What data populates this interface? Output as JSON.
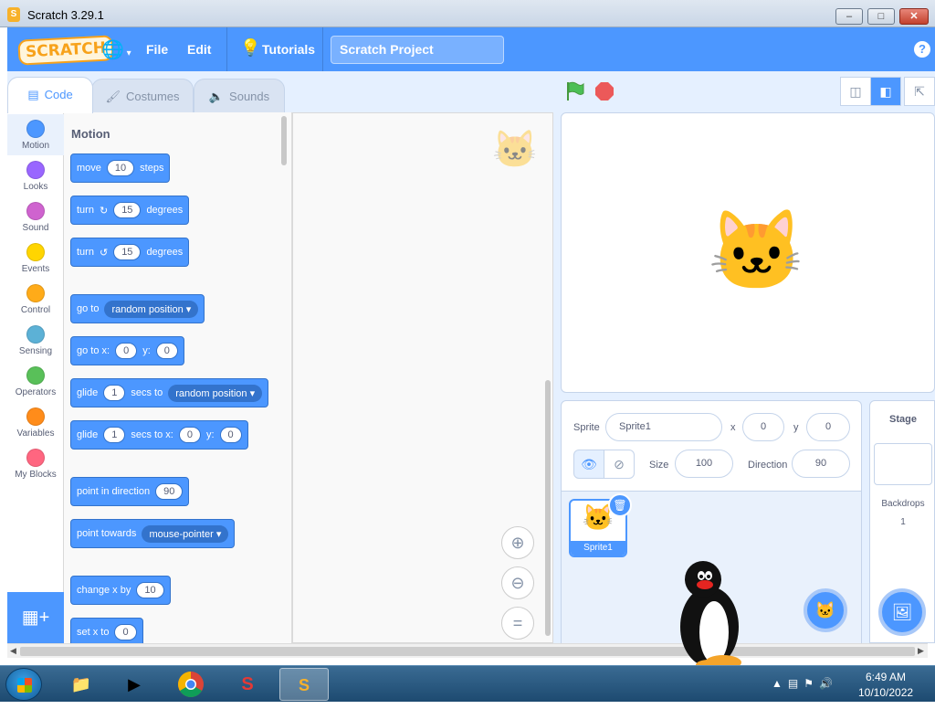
{
  "window": {
    "title": "Scratch 3.29.1"
  },
  "menubar": {
    "logo": "SCRATCH",
    "file": "File",
    "edit": "Edit",
    "tutorials": "Tutorials",
    "project_title": "Scratch Project",
    "help": "?"
  },
  "tabs": [
    {
      "label": "Code",
      "active": true
    },
    {
      "label": "Costumes",
      "active": false
    },
    {
      "label": "Sounds",
      "active": false
    }
  ],
  "categories": [
    {
      "label": "Motion",
      "color": "#4c97ff"
    },
    {
      "label": "Looks",
      "color": "#9966ff"
    },
    {
      "label": "Sound",
      "color": "#cf63cf"
    },
    {
      "label": "Events",
      "color": "#ffd500"
    },
    {
      "label": "Control",
      "color": "#ffab19"
    },
    {
      "label": "Sensing",
      "color": "#5cb1d6"
    },
    {
      "label": "Operators",
      "color": "#59c059"
    },
    {
      "label": "Variables",
      "color": "#ff8c1a"
    },
    {
      "label": "My Blocks",
      "color": "#ff6680"
    }
  ],
  "palette": {
    "title": "Motion",
    "blocks": {
      "move": {
        "a": "move",
        "v": "10",
        "b": "steps"
      },
      "turn_right": {
        "a": "turn",
        "v": "15",
        "b": "degrees"
      },
      "turn_left": {
        "a": "turn",
        "v": "15",
        "b": "degrees"
      },
      "goto": {
        "a": "go to",
        "drop": "random position"
      },
      "gotoxy": {
        "a": "go to x:",
        "x": "0",
        "b": "y:",
        "y": "0"
      },
      "glide_to": {
        "a": "glide",
        "v": "1",
        "b": "secs to",
        "drop": "random position"
      },
      "glide_xy": {
        "a": "glide",
        "v": "1",
        "b": "secs to x:",
        "x": "0",
        "c": "y:",
        "y": "0"
      },
      "point_dir": {
        "a": "point in direction",
        "v": "90"
      },
      "point_towards": {
        "a": "point towards",
        "drop": "mouse-pointer"
      },
      "change_x": {
        "a": "change x by",
        "v": "10"
      },
      "set_x": {
        "a": "set x to",
        "v": "0"
      }
    }
  },
  "sprite_info": {
    "sprite_label": "Sprite",
    "sprite_name": "Sprite1",
    "x_label": "x",
    "x_value": "0",
    "y_label": "y",
    "y_value": "0",
    "size_label": "Size",
    "size_value": "100",
    "direction_label": "Direction",
    "direction_value": "90"
  },
  "sprites": [
    {
      "name": "Sprite1"
    }
  ],
  "stage_pane": {
    "title": "Stage",
    "backdrops_label": "Backdrops",
    "backdrops_count": "1"
  },
  "taskbar": {
    "time": "6:49 AM",
    "date": "10/10/2022"
  }
}
